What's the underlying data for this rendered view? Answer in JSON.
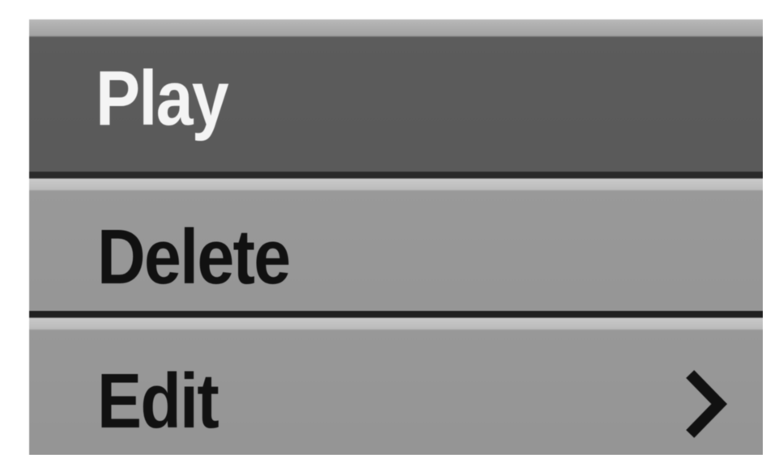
{
  "menu": {
    "items": [
      {
        "label": "Play",
        "selected": true
      },
      {
        "label": "Delete",
        "selected": false
      },
      {
        "label": "Edit",
        "selected": false,
        "submenu_icon": "chevron-right-icon"
      }
    ],
    "colors": {
      "selected_background": "#5a5a5a",
      "selected_text": "#f4f4f4",
      "item_background": "#969696",
      "item_text": "#111111"
    }
  }
}
